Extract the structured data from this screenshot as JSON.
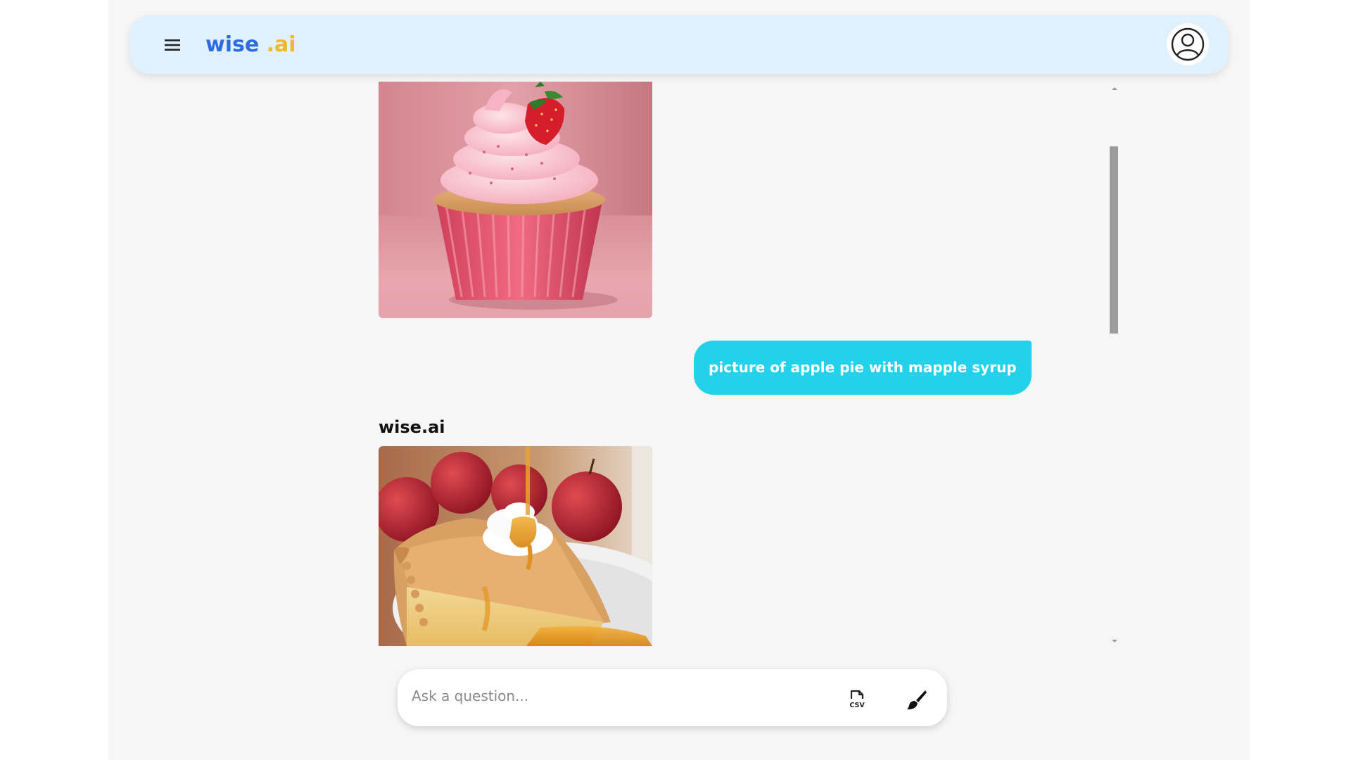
{
  "app": {
    "brand_main": "wise",
    "brand_accent": ".ai",
    "colors": {
      "brand_blue": "#2f6be0",
      "brand_gold": "#f2b82c",
      "header_bg": "#e0f0fc",
      "user_bubble": "#23d1ea"
    }
  },
  "header": {
    "menu_icon": "hamburger-menu-icon",
    "account_icon": "user-account-icon"
  },
  "conversation": {
    "messages": [
      {
        "role": "assistant",
        "type": "image",
        "subject": "cupcake-image"
      },
      {
        "role": "user",
        "type": "text",
        "text": "picture of apple pie with mapple syrup"
      },
      {
        "role": "assistant",
        "type": "image",
        "sender": "wise.ai",
        "subject": "apple-pie-image"
      }
    ]
  },
  "composer": {
    "placeholder": "Ask a question...",
    "value": "",
    "csv_label": "CSV",
    "csv_icon": "csv-file-icon",
    "brush_icon": "paint-brush-icon"
  }
}
